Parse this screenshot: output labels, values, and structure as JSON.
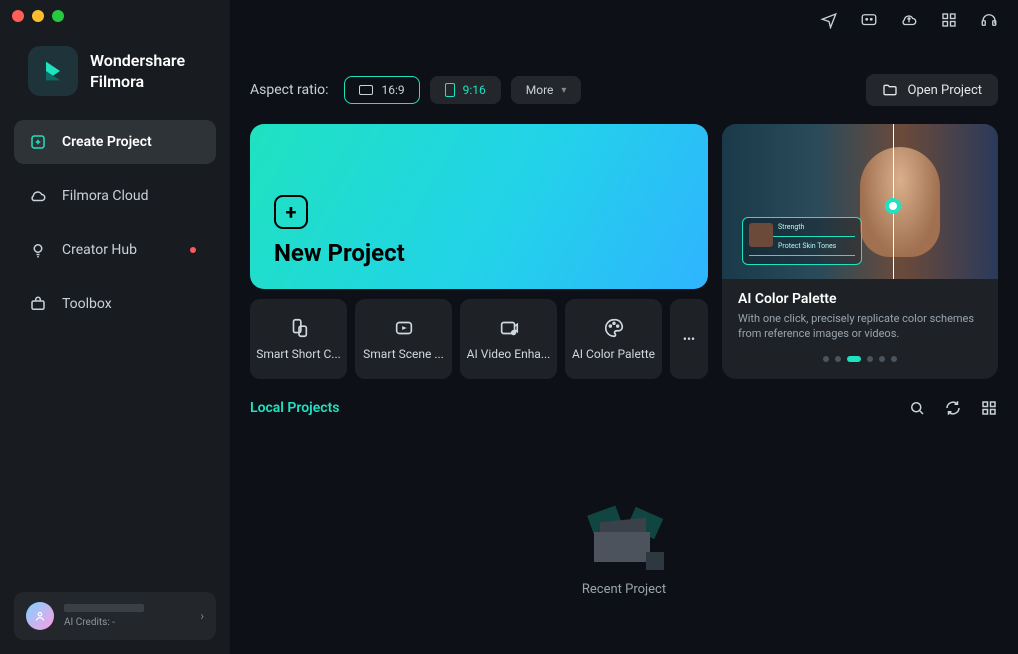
{
  "brand": {
    "line1": "Wondershare",
    "line2": "Filmora"
  },
  "sidebar": {
    "items": [
      {
        "label": "Create Project"
      },
      {
        "label": "Filmora Cloud"
      },
      {
        "label": "Creator Hub"
      },
      {
        "label": "Toolbox"
      }
    ]
  },
  "aspect": {
    "label": "Aspect ratio:",
    "ratio169": "16:9",
    "ratio916": "9:16",
    "more": "More"
  },
  "open_project": "Open Project",
  "new_project": "New Project",
  "tools": [
    {
      "label": "Smart Short C..."
    },
    {
      "label": "Smart Scene ..."
    },
    {
      "label": "AI Video Enha..."
    },
    {
      "label": "AI Color Palette"
    }
  ],
  "feature": {
    "title": "AI Color Palette",
    "desc": "With one click, precisely replicate color schemes from reference images or videos.",
    "overlay_line1": "Strength",
    "overlay_line2": "Protect Skin Tones"
  },
  "local_projects_title": "Local Projects",
  "recent_project": "Recent Project",
  "user": {
    "credits": "AI Credits: -"
  }
}
